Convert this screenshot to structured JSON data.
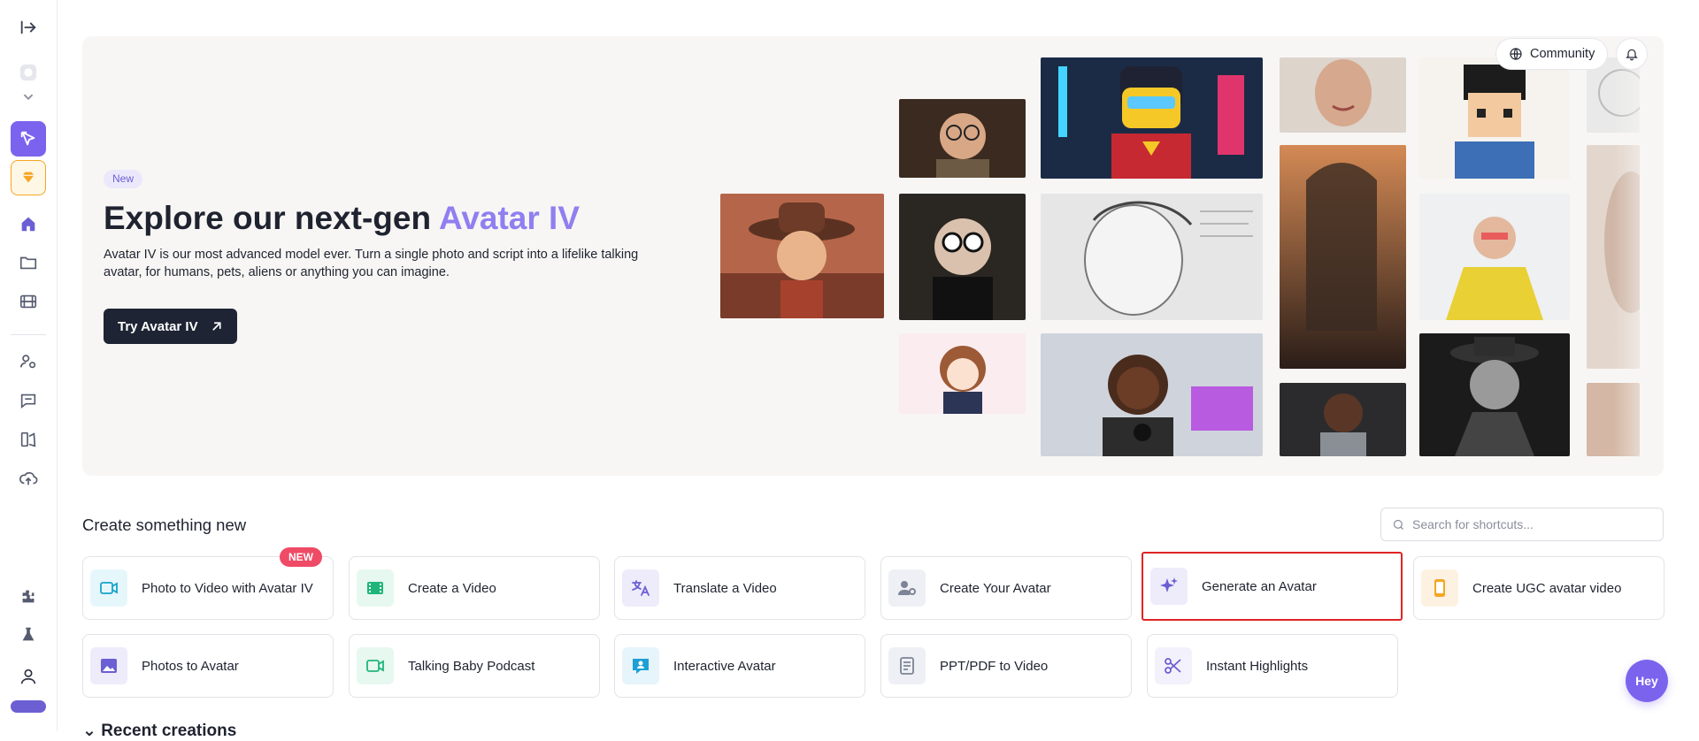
{
  "header": {
    "community_label": "Community"
  },
  "hero": {
    "badge": "New",
    "title_prefix": "Explore our next-gen ",
    "title_accent": "Avatar IV",
    "description": "Avatar IV is our most advanced model ever. Turn a single photo and script into a lifelike talking avatar, for humans, pets, aliens or anything you can imagine.",
    "cta_label": "Try Avatar IV"
  },
  "create_section": {
    "title": "Create something new",
    "search_placeholder": "Search for shortcuts...",
    "cards": [
      {
        "label": "Photo to Video with Avatar IV",
        "icon": "video-camera-icon",
        "badge": "NEW"
      },
      {
        "label": "Create a Video",
        "icon": "film-icon"
      },
      {
        "label": "Translate a Video",
        "icon": "translate-icon"
      },
      {
        "label": "Create Your Avatar",
        "icon": "user-settings-icon"
      },
      {
        "label": "Generate an Avatar",
        "icon": "sparkles-icon",
        "selected": true
      },
      {
        "label": "Create UGC avatar video",
        "icon": "phone-icon"
      },
      {
        "label": "Photos to Avatar",
        "icon": "image-icon"
      },
      {
        "label": "Talking Baby Podcast",
        "icon": "video-camera-icon"
      },
      {
        "label": "Interactive Avatar",
        "icon": "chat-user-icon"
      },
      {
        "label": "PPT/PDF to Video",
        "icon": "document-icon"
      },
      {
        "label": "Instant Highlights",
        "icon": "scissors-icon"
      }
    ]
  },
  "recent": {
    "title": "Recent creations"
  },
  "chat_bubble": {
    "label": "Hey"
  },
  "colors": {
    "accent": "#7b63ee",
    "title_accent": "#8f7ff0",
    "cta_bg": "#1e2433",
    "new_badge": "#ef4a66",
    "selected_outline": "#e02424"
  }
}
